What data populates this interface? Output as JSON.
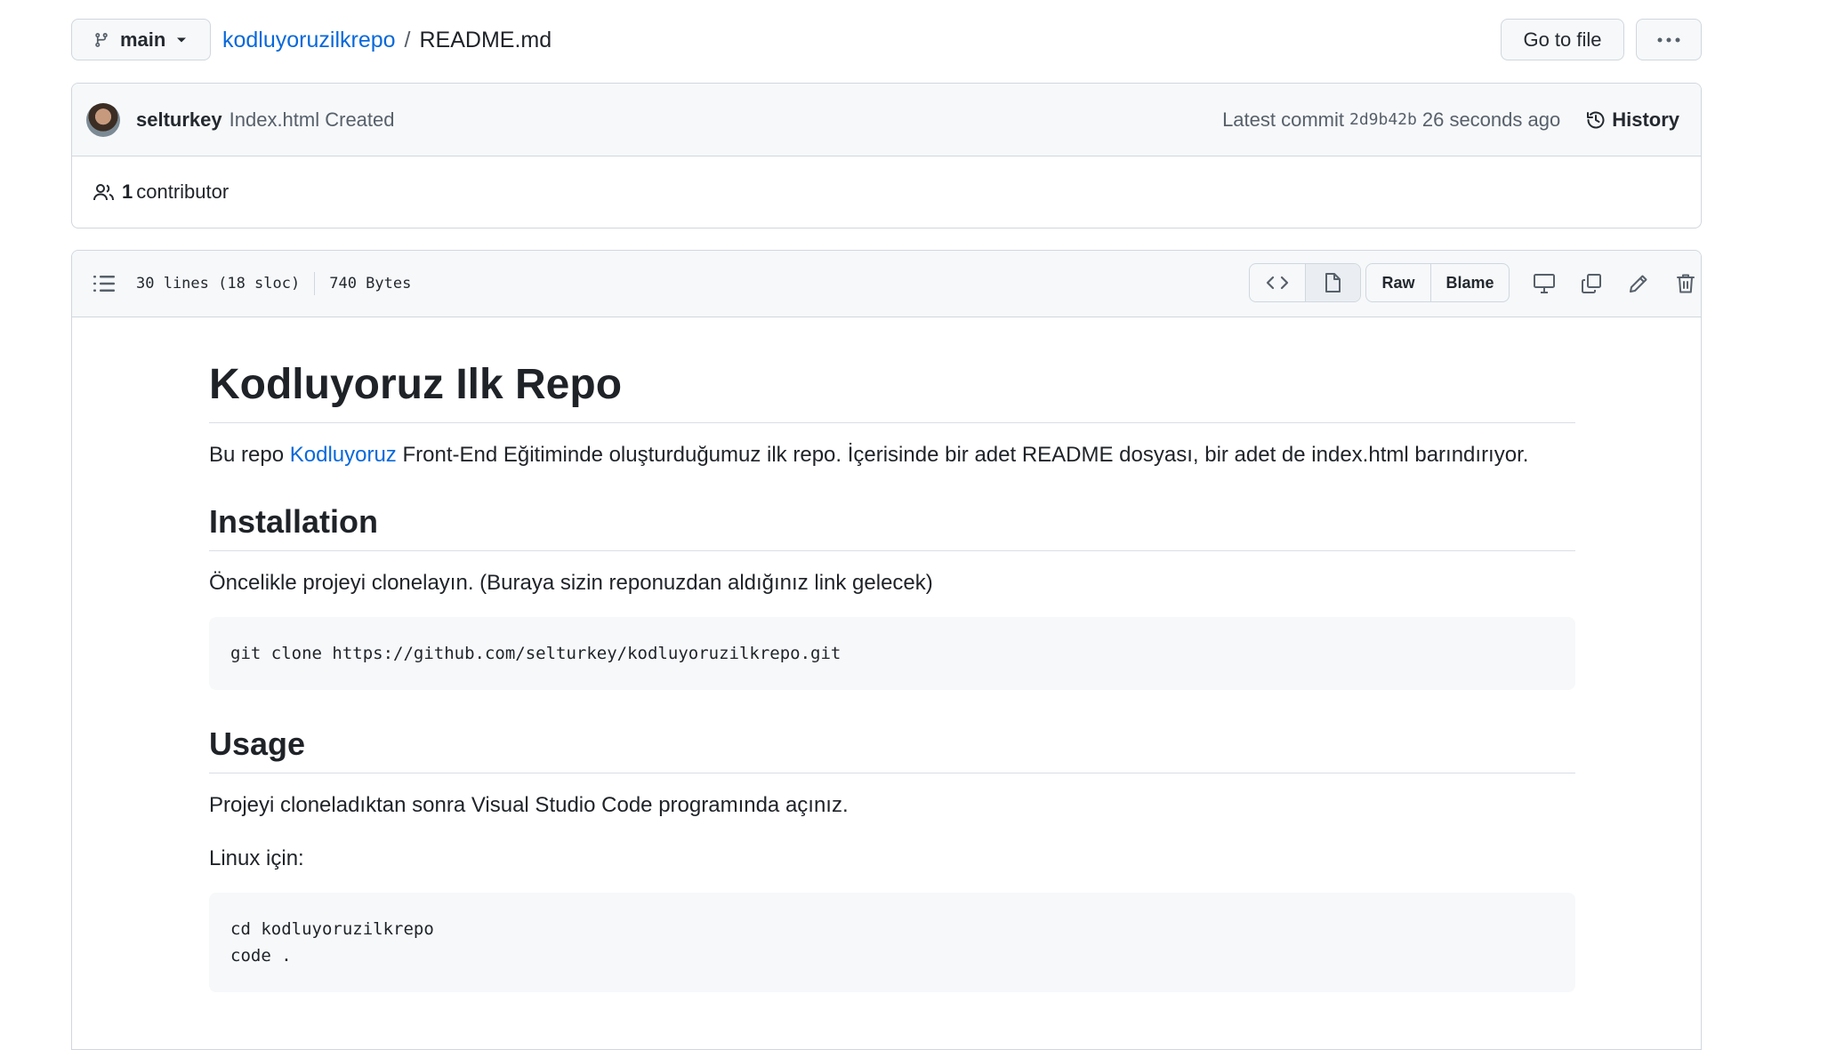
{
  "topbar": {
    "branch": "main",
    "repo": "kodluyoruzilkrepo",
    "separator": "/",
    "file": "README.md",
    "goto_file": "Go to file"
  },
  "commit": {
    "author": "selturkey",
    "message": "Index.html Created",
    "latest_label": "Latest commit",
    "sha": "2d9b42b",
    "time": "26 seconds ago",
    "history": "History",
    "contributors_count": "1",
    "contributors_label": "contributor"
  },
  "file": {
    "lines": "30 lines (18 sloc)",
    "size": "740 Bytes",
    "raw": "Raw",
    "blame": "Blame"
  },
  "readme": {
    "title": "Kodluyoruz Ilk Repo",
    "intro_before": "Bu repo ",
    "intro_link": "Kodluyoruz",
    "intro_after": " Front-End Eğitiminde oluşturduğumuz ilk repo. İçerisinde bir adet README dosyası, bir adet de index.html barındırıyor.",
    "h_installation": "Installation",
    "install_text": "Öncelikle projeyi clonelayın. (Buraya sizin reponuzdan aldığınız link gelecek)",
    "install_code": "git clone https://github.com/selturkey/kodluyoruzilkrepo.git",
    "h_usage": "Usage",
    "usage_text": "Projeyi cloneladıktan sonra Visual Studio Code programında açınız.",
    "linux_label": "Linux için:",
    "usage_code": "cd kodluyoruzilkrepo\ncode ."
  },
  "colors": {
    "link": "#0969da",
    "border": "#d0d7de",
    "header_bg": "#f6f8fa"
  }
}
